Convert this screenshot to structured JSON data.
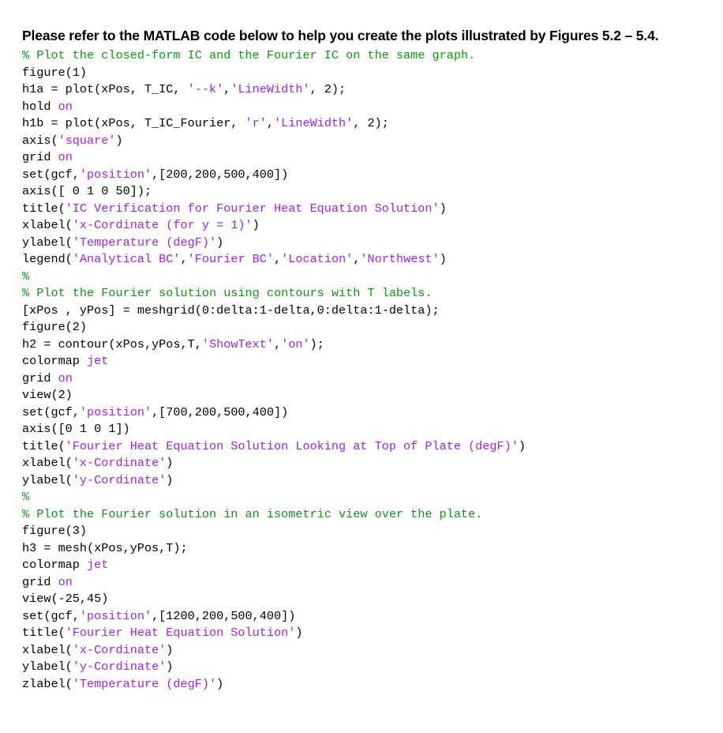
{
  "colors": {
    "plain": "#000000",
    "string": "#a020f0",
    "comment": "#0b9a0b",
    "keyword": "#0000ff",
    "background": "#ffffff"
  },
  "instruction": {
    "text": "Please refer to the MATLAB code below to help you create the plots illustrated by Figures 5.2 – 5.4."
  },
  "code": {
    "language": "MATLAB",
    "lines": [
      [
        [
          "% Plot the closed-form IC and the Fourier IC on the same graph.",
          "comment"
        ]
      ],
      [
        [
          "figure(1)",
          "plain"
        ]
      ],
      [
        [
          "h1a = plot(xPos, T_IC, ",
          "plain"
        ],
        [
          "'--k'",
          "string"
        ],
        [
          ",",
          "plain"
        ],
        [
          "'LineWidth'",
          "string"
        ],
        [
          ", 2);",
          "plain"
        ]
      ],
      [
        [
          "hold ",
          "plain"
        ],
        [
          "on",
          "string"
        ]
      ],
      [
        [
          "h1b = plot(xPos, T_IC_Fourier, ",
          "plain"
        ],
        [
          "'r'",
          "string"
        ],
        [
          ",",
          "plain"
        ],
        [
          "'LineWidth'",
          "string"
        ],
        [
          ", 2);",
          "plain"
        ]
      ],
      [
        [
          "axis(",
          "plain"
        ],
        [
          "'square'",
          "string"
        ],
        [
          ")",
          "plain"
        ]
      ],
      [
        [
          "grid ",
          "plain"
        ],
        [
          "on",
          "string"
        ]
      ],
      [
        [
          "set(gcf,",
          "plain"
        ],
        [
          "'position'",
          "string"
        ],
        [
          ",[200,200,500,400])",
          "plain"
        ]
      ],
      [
        [
          "axis([ 0 1 0 50]);",
          "plain"
        ]
      ],
      [
        [
          "title(",
          "plain"
        ],
        [
          "'IC Verification for Fourier Heat Equation Solution'",
          "string"
        ],
        [
          ")",
          "plain"
        ]
      ],
      [
        [
          "xlabel(",
          "plain"
        ],
        [
          "'x-Cordinate (for y = 1)'",
          "string"
        ],
        [
          ")",
          "plain"
        ]
      ],
      [
        [
          "ylabel(",
          "plain"
        ],
        [
          "'Temperature (degF)'",
          "string"
        ],
        [
          ")",
          "plain"
        ]
      ],
      [
        [
          "legend(",
          "plain"
        ],
        [
          "'Analytical BC'",
          "string"
        ],
        [
          ",",
          "plain"
        ],
        [
          "'Fourier BC'",
          "string"
        ],
        [
          ",",
          "plain"
        ],
        [
          "'Location'",
          "string"
        ],
        [
          ",",
          "plain"
        ],
        [
          "'Northwest'",
          "string"
        ],
        [
          ")",
          "plain"
        ]
      ],
      [
        [
          "%",
          "comment"
        ]
      ],
      [
        [
          "% Plot the Fourier solution using contours with T labels.",
          "comment"
        ]
      ],
      [
        [
          "[xPos , yPos] = meshgrid(0:delta:1-delta,0:delta:1-delta);",
          "plain"
        ]
      ],
      [
        [
          "figure(2)",
          "plain"
        ]
      ],
      [
        [
          "h2 = contour(xPos,yPos,T,",
          "plain"
        ],
        [
          "'ShowText'",
          "string"
        ],
        [
          ",",
          "plain"
        ],
        [
          "'on'",
          "string"
        ],
        [
          ");",
          "plain"
        ]
      ],
      [
        [
          "colormap ",
          "plain"
        ],
        [
          "jet",
          "string"
        ]
      ],
      [
        [
          "grid ",
          "plain"
        ],
        [
          "on",
          "string"
        ]
      ],
      [
        [
          "view(2)",
          "plain"
        ]
      ],
      [
        [
          "set(gcf,",
          "plain"
        ],
        [
          "'position'",
          "string"
        ],
        [
          ",[700,200,500,400])",
          "plain"
        ]
      ],
      [
        [
          "axis([0 1 0 1])",
          "plain"
        ]
      ],
      [
        [
          "title(",
          "plain"
        ],
        [
          "'Fourier Heat Equation Solution Looking at Top of Plate (degF)'",
          "string"
        ],
        [
          ")",
          "plain"
        ]
      ],
      [
        [
          "xlabel(",
          "plain"
        ],
        [
          "'x-Cordinate'",
          "string"
        ],
        [
          ")",
          "plain"
        ]
      ],
      [
        [
          "ylabel(",
          "plain"
        ],
        [
          "'y-Cordinate'",
          "string"
        ],
        [
          ")",
          "plain"
        ]
      ],
      [
        [
          "%",
          "comment"
        ]
      ],
      [
        [
          "% Plot the Fourier solution in an isometric view over the plate.",
          "comment"
        ]
      ],
      [
        [
          "figure(3)",
          "plain"
        ]
      ],
      [
        [
          "h3 = mesh(xPos,yPos,T);",
          "plain"
        ]
      ],
      [
        [
          "colormap ",
          "plain"
        ],
        [
          "jet",
          "string"
        ]
      ],
      [
        [
          "grid ",
          "plain"
        ],
        [
          "on",
          "string"
        ]
      ],
      [
        [
          "view(-25,45)",
          "plain"
        ]
      ],
      [
        [
          "set(gcf,",
          "plain"
        ],
        [
          "'position'",
          "string"
        ],
        [
          ",[1200,200,500,400])",
          "plain"
        ]
      ],
      [
        [
          "title(",
          "plain"
        ],
        [
          "'Fourier Heat Equation Solution'",
          "string"
        ],
        [
          ")",
          "plain"
        ]
      ],
      [
        [
          "xlabel(",
          "plain"
        ],
        [
          "'x-Cordinate'",
          "string"
        ],
        [
          ")",
          "plain"
        ]
      ],
      [
        [
          "ylabel(",
          "plain"
        ],
        [
          "'y-Cordinate'",
          "string"
        ],
        [
          ")",
          "plain"
        ]
      ],
      [
        [
          "zlabel(",
          "plain"
        ],
        [
          "'Temperature (degF)'",
          "string"
        ],
        [
          ")",
          "plain"
        ]
      ]
    ]
  }
}
